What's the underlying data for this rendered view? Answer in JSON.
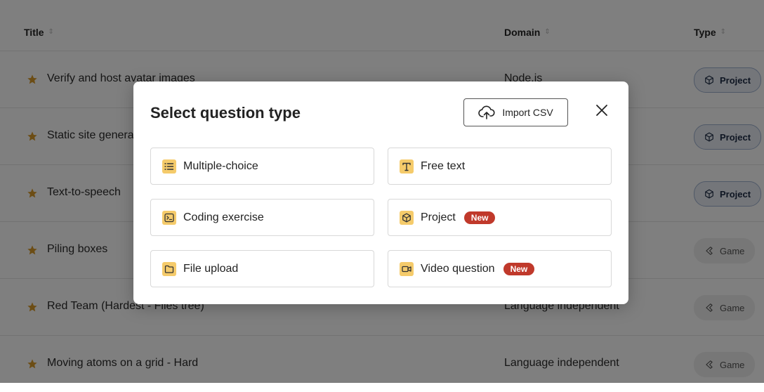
{
  "table": {
    "columns": [
      {
        "label": "Title"
      },
      {
        "label": "Domain"
      },
      {
        "label": "Type"
      }
    ],
    "rows": [
      {
        "title": "Verify and host avatar images",
        "domain": "Node.js",
        "type": "Project",
        "type_icon": "cube-icon"
      },
      {
        "title": "Static site generator",
        "domain": "",
        "type": "Project",
        "type_icon": "cube-icon"
      },
      {
        "title": "Text-to-speech",
        "domain": "",
        "type": "Project",
        "type_icon": "cube-icon"
      },
      {
        "title": "Piling boxes",
        "domain": "",
        "type": "Game",
        "type_icon": "game-icon"
      },
      {
        "title": "Red Team (Hardest - Files tree)",
        "domain": "Language independent",
        "type": "Game",
        "type_icon": "game-icon"
      },
      {
        "title": "Moving atoms on a grid - Hard",
        "domain": "Language independent",
        "type": "Game",
        "type_icon": "game-icon"
      }
    ],
    "star_color": "#d99a2b"
  },
  "modal": {
    "title": "Select question type",
    "import_label": "Import CSV",
    "new_badge": "New",
    "options": [
      {
        "label": "Multiple-choice",
        "icon": "list-icon",
        "is_new": false
      },
      {
        "label": "Free text",
        "icon": "text-icon",
        "is_new": false
      },
      {
        "label": "Coding exercise",
        "icon": "terminal-icon",
        "is_new": false
      },
      {
        "label": "Project",
        "icon": "cube-icon",
        "is_new": true
      },
      {
        "label": "File upload",
        "icon": "folder-icon",
        "is_new": false
      },
      {
        "label": "Video question",
        "icon": "video-icon",
        "is_new": true
      }
    ],
    "accent": "#f5cb6b",
    "badge_color": "#c0392b"
  }
}
